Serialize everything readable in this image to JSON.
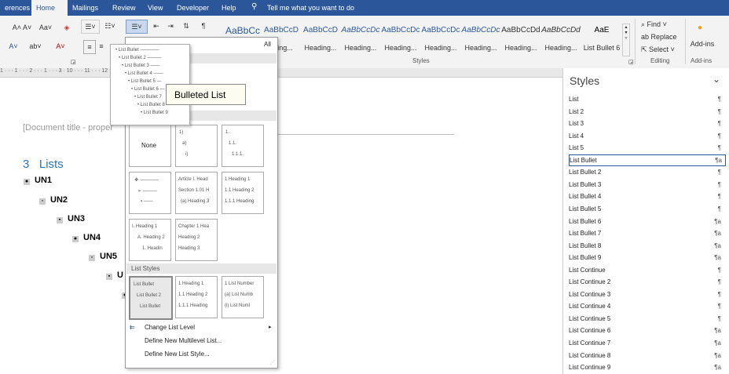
{
  "tabs": [
    {
      "label": "erences"
    },
    {
      "label": "Home"
    },
    {
      "label": "Mailings"
    },
    {
      "label": "Review"
    },
    {
      "label": "View"
    },
    {
      "label": "Developer"
    },
    {
      "label": "Help"
    }
  ],
  "tell_me": "Tell me what you want to do",
  "ribbon": {
    "font_group_label": "",
    "styles_label": "Styles",
    "editing_label": "Editing",
    "addins_group_label": "Add-ins",
    "find": "Find",
    "replace": "Replace",
    "select": "Select",
    "addins": "Add-ins",
    "gallery": [
      {
        "preview": "AaBbCc",
        "name": ""
      },
      {
        "preview": "AaBbCcD",
        "name": "ading..."
      },
      {
        "preview": "AaBbCcD",
        "name": "Heading..."
      },
      {
        "preview": "AaBbCcDc",
        "name": "Heading..."
      },
      {
        "preview": "AaBbCcDc",
        "name": "Heading..."
      },
      {
        "preview": "AaBbCcDc",
        "name": "Heading..."
      },
      {
        "preview": "AaBbCcDc",
        "name": "Heading..."
      },
      {
        "preview": "AaBbCcDd",
        "name": "Heading..."
      },
      {
        "preview": "AaBbCcDd",
        "name": "Heading..."
      },
      {
        "preview": "AaE",
        "name": "List Bullet 6"
      }
    ]
  },
  "ruler_text": "1 · · · 1 · · · 2 · · · 1 · · · 3 ·                                                          10 · · · 11 · · · 12 · · · 13 · · · 14 · · · 15 · · · 16 · · · 17 · · · 18 · · · 19",
  "document": {
    "title_field": "[Document title - proper",
    "heading_num": "3",
    "heading_text": "Lists",
    "bullets": [
      "UN1",
      "UN2",
      "UN3",
      "UN4",
      "UN5",
      "U",
      ""
    ]
  },
  "dropdown": {
    "all_label": "All",
    "list_library_label": "",
    "list_styles_label": "List Styles",
    "none_label": "None",
    "tiles": {
      "t2": [
        "1)",
        "a)",
        "i)"
      ],
      "t3": [
        "1.",
        "1.1.",
        "1.1.1."
      ],
      "t5": [
        "Article I. Head",
        "Section 1.01 H",
        "(a) Heading 3"
      ],
      "t6": [
        "1 Heading 1",
        "1.1 Heading 2",
        "1.1.1 Heading"
      ],
      "t7": [
        "I. Heading 1",
        "A. Heading 2",
        "1. Headin"
      ],
      "t8": [
        "Chapter 1 Hea",
        "Heading 2",
        "Heading 3"
      ],
      "ls1": [
        "List Bullet",
        "List Bullet 2",
        "List Bullet"
      ],
      "ls2": [
        "1 Heading 1",
        "1.1 Heading 2",
        "1.1.1 Heading"
      ],
      "ls3": [
        "1 List Number",
        "(a) List Numb",
        "(i) List Numl"
      ]
    },
    "menu": [
      "Change List Level",
      "Define New Multilevel List...",
      "Define New List Style..."
    ]
  },
  "flyout_lines": [
    "List Bullet",
    "List Bullet 2",
    "List Bullet 3",
    "List Bullet 4",
    "List Bullet 5",
    "List Bullet 6",
    "List Bullet 7",
    "List Bullet 8",
    "List Bullet 9"
  ],
  "tooltip": "Bulleted List",
  "styles_pane": {
    "title": "Styles",
    "selected": "List Bullet",
    "rows": [
      {
        "name": "List",
        "mark": "¶"
      },
      {
        "name": "List 2",
        "mark": "¶"
      },
      {
        "name": "List 3",
        "mark": "¶"
      },
      {
        "name": "List 4",
        "mark": "¶"
      },
      {
        "name": "List 5",
        "mark": "¶"
      },
      {
        "name": "List Bullet",
        "mark": "¶a"
      },
      {
        "name": "List Bullet 2",
        "mark": "¶"
      },
      {
        "name": "List Bullet 3",
        "mark": "¶"
      },
      {
        "name": "List Bullet 4",
        "mark": "¶"
      },
      {
        "name": "List Bullet 5",
        "mark": "¶"
      },
      {
        "name": "List Bullet 6",
        "mark": "¶a"
      },
      {
        "name": "List Bullet 7",
        "mark": "¶a"
      },
      {
        "name": "List Bullet 8",
        "mark": "¶a"
      },
      {
        "name": "List Bullet 9",
        "mark": "¶a"
      },
      {
        "name": "List Continue",
        "mark": "¶"
      },
      {
        "name": "List Continue 2",
        "mark": "¶"
      },
      {
        "name": "List Continue 3",
        "mark": "¶"
      },
      {
        "name": "List Continue 4",
        "mark": "¶"
      },
      {
        "name": "List Continue 5",
        "mark": "¶"
      },
      {
        "name": "List Continue 6",
        "mark": "¶a"
      },
      {
        "name": "List Continue 7",
        "mark": "¶a"
      },
      {
        "name": "List Continue 8",
        "mark": "¶a"
      },
      {
        "name": "List Continue 9",
        "mark": "¶a"
      }
    ]
  },
  "colors": {
    "brand": "#2b579a",
    "heading": "#2e74b5"
  },
  "icons": [
    "lightbulb-icon",
    "search-icon",
    "replace-icon",
    "select-icon",
    "addins-icon",
    "change-level-icon",
    "close-icon"
  ]
}
